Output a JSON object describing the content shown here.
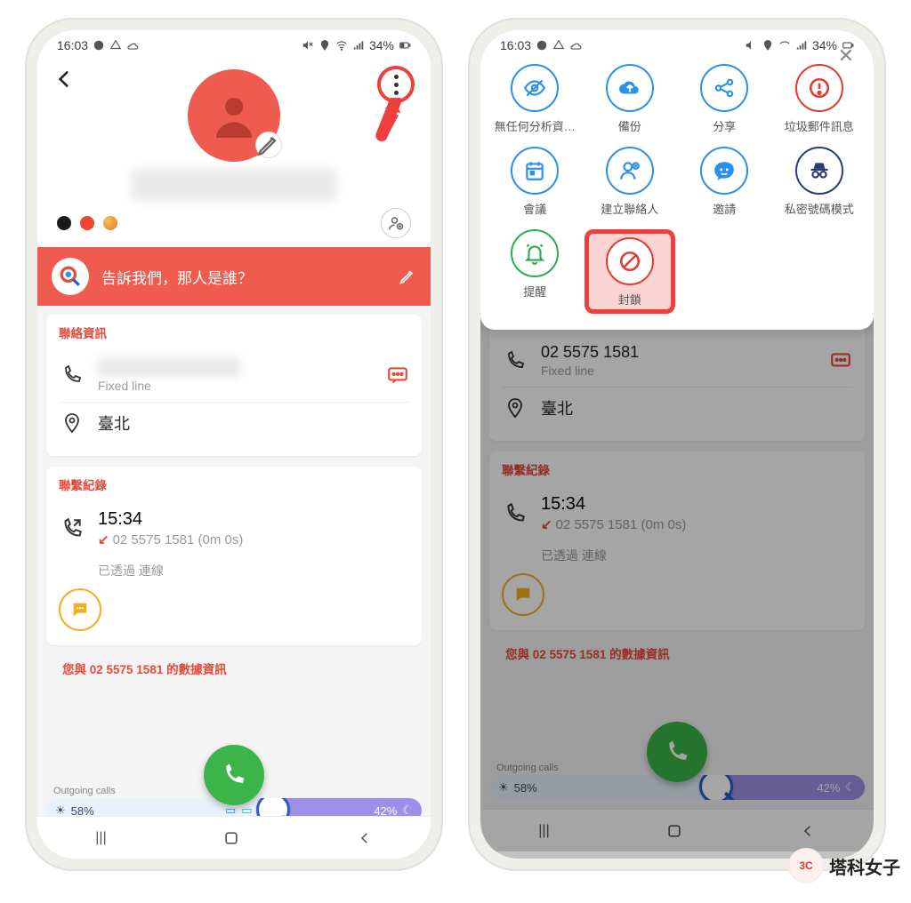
{
  "status": {
    "time": "16:03",
    "battery": "34%"
  },
  "banner": {
    "prompt": "告訴我們，那人是誰？"
  },
  "sections": {
    "contact": "聯絡資訊",
    "history": "聯繫紀錄",
    "data": "數據資訊"
  },
  "contact": {
    "phone": "02 5575 1581",
    "line_type": "Fixed line",
    "location": "臺北"
  },
  "history": {
    "time": "15:34",
    "detail": "02 5575 1581 (0m 0s)",
    "via": "已透過 連線"
  },
  "data_info_prefix": "您與 02 5575 1581 的",
  "stats": {
    "label": "Outgoing calls",
    "left_pct": "58%",
    "right_pct": "42%"
  },
  "sheet": {
    "analytics": "無任何分析資…",
    "backup": "備份",
    "share": "分享",
    "spam": "垃圾郵件訊息",
    "meeting": "會議",
    "create_contact": "建立聯絡人",
    "invite": "邀請",
    "private": "私密號碼模式",
    "remind": "提醒",
    "block": "封鎖"
  },
  "brand": "塔科女子"
}
